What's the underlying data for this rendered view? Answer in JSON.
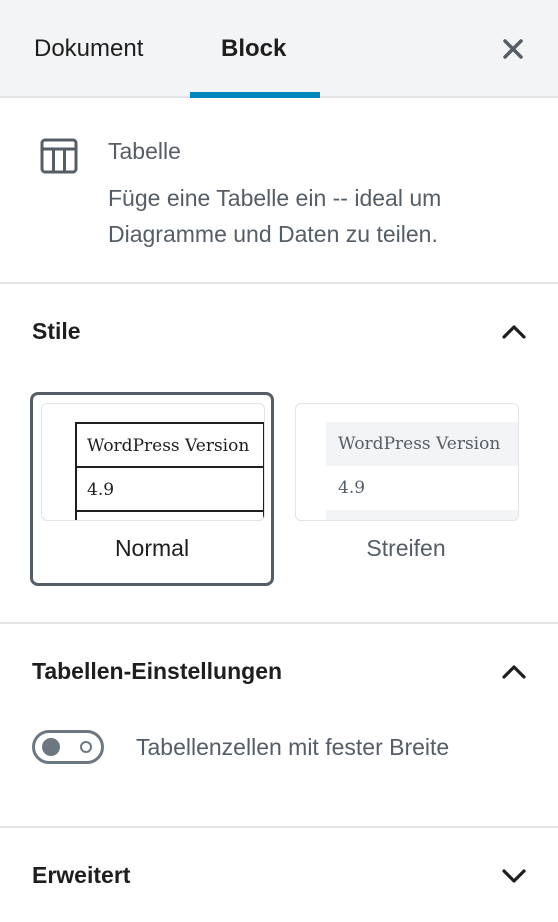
{
  "tabs": {
    "dokument": "Dokument",
    "block": "Block",
    "active": "Block",
    "close_icon": "close-icon"
  },
  "block": {
    "icon": "table-icon",
    "title": "Tabelle",
    "description": "Füge eine Tabelle ein -- ideal um Diagramme und Daten zu teilen."
  },
  "styles_panel": {
    "title": "Stile",
    "expanded": true,
    "options": [
      {
        "label": "Normal",
        "selected": true,
        "preview_rows": [
          "WordPress Version",
          "4.9"
        ]
      },
      {
        "label": "Streifen",
        "selected": false,
        "preview_rows": [
          "WordPress Version",
          "4.9"
        ]
      }
    ]
  },
  "table_settings_panel": {
    "title": "Tabellen-Einstellungen",
    "expanded": true,
    "toggle_label": "Tabellenzellen mit fester Breite",
    "toggle_on": false
  },
  "advanced_panel": {
    "title": "Erweitert",
    "expanded": false
  },
  "colors": {
    "accent": "#0087be",
    "text": "#1e1e1e",
    "muted": "#555d66",
    "border": "#e2e4e7",
    "header_bg": "#f3f4f5"
  }
}
